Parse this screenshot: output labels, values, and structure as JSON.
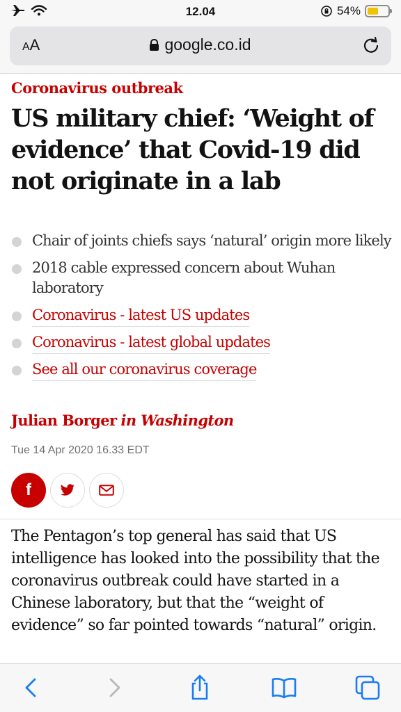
{
  "status_bar": {
    "time": "12.04",
    "battery_percent": "54%",
    "battery_level": 0.54
  },
  "browser": {
    "text_size_label_small": "A",
    "text_size_label_large": "A",
    "domain": "google.co.id"
  },
  "article": {
    "kicker": "Coronavirus outbreak",
    "headline": "US military chief: ‘Weight of evidence’ that Covid-19 did not originate in a lab",
    "bullets": [
      {
        "text": "Chair of joints chiefs says ‘natural’ origin more likely"
      },
      {
        "text": "2018 cable expressed concern about Wuhan laboratory"
      },
      {
        "text": "Coronavirus - latest US updates"
      },
      {
        "text": "Coronavirus - latest global updates"
      },
      {
        "text": "See all our coronavirus coverage"
      }
    ],
    "byline": {
      "author": "Julian Borger",
      "location": "in Washington"
    },
    "date": "Tue 14 Apr 2020 16.33 EDT",
    "share": {
      "facebook_label": "f"
    },
    "body": "The Pentagon’s top general has said that US intelligence has looked into the possibility that the coronavirus outbreak could have started in a Chinese laboratory, but that the “weight of evidence” so far pointed towards “natural” origin."
  },
  "colors": {
    "accent": "#c70000",
    "ios_blue": "#1a7cf5"
  }
}
